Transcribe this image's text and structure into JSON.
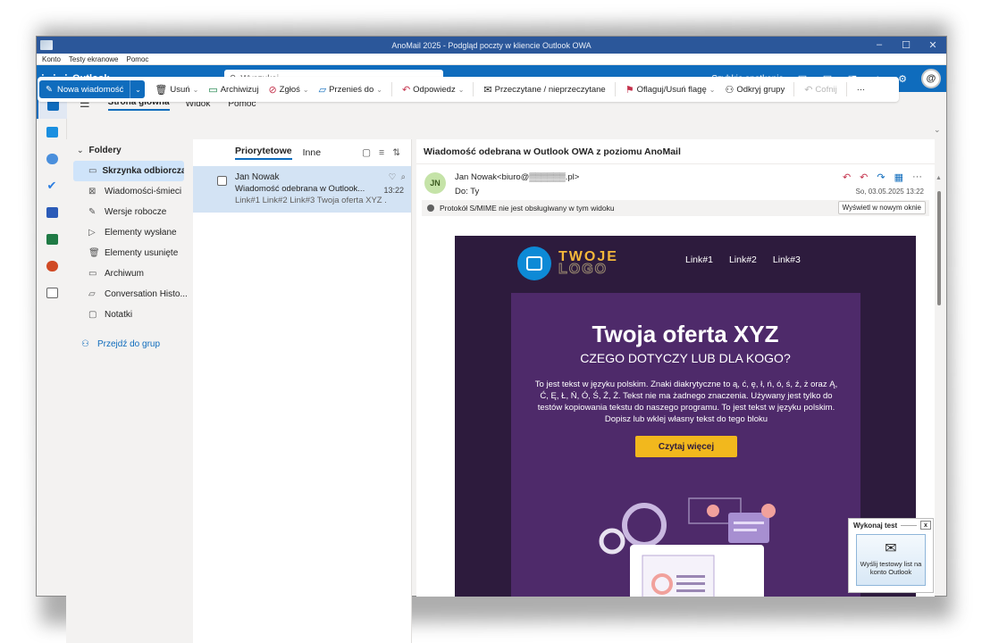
{
  "window": {
    "title": "AnoMail 2025 - Podgląd poczty w kliencie Outlook OWA",
    "controls": [
      "–",
      "☐",
      "✕"
    ]
  },
  "menubar": [
    "Konto",
    "Testy ekranowe",
    "Pomoc"
  ],
  "header": {
    "brand": "Outlook",
    "search_placeholder": "Wyszukaj",
    "quick_meeting": "Szybkie spotkanie"
  },
  "ribbon_tabs": [
    "Strona główna",
    "Widok",
    "Pomoc"
  ],
  "ribbon": {
    "new_mail": "Nowa wiadomość",
    "delete": "Usuń",
    "archive": "Archiwizuj",
    "report": "Zgłoś",
    "move_to": "Przenieś do",
    "reply": "Odpowiedz",
    "read_unread": "Przeczytane / nieprzeczytane",
    "flag": "Oflaguj/Usuń flagę",
    "discover_groups": "Odkryj grupy",
    "undo": "Cofnij",
    "more": "···"
  },
  "folders": {
    "header": "Foldery",
    "items": [
      {
        "label": "Skrzynka odbiorcza",
        "icon": "inbox-icon"
      },
      {
        "label": "Wiadomości-śmieci",
        "icon": "junk-icon"
      },
      {
        "label": "Wersje robocze",
        "icon": "draft-icon"
      },
      {
        "label": "Elementy wysłane",
        "icon": "send-icon"
      },
      {
        "label": "Elementy usunięte",
        "icon": "trash-icon"
      },
      {
        "label": "Archiwum",
        "icon": "archive-icon"
      },
      {
        "label": "Conversation Histo...",
        "icon": "folder-icon"
      },
      {
        "label": "Notatki",
        "icon": "note-icon"
      }
    ],
    "go_to_groups": "Przejdź do grup"
  },
  "message_list": {
    "tab_focused": "Priorytetowe",
    "tab_other": "Inne",
    "messages": [
      {
        "from": "Jan Nowak",
        "subject": "Wiadomość odebrana w Outlook...",
        "time": "13:22",
        "preview": "Link#1 Link#2 Link#3 Twoja oferta XYZ ..."
      }
    ]
  },
  "reading": {
    "subject": "Wiadomość odebrana w Outlook OWA z poziomu AnoMail",
    "avatar_initials": "JN",
    "sender": "Jan Nowak<biuro@▒▒▒▒▒▒.pl>",
    "to": "Do:  Ty",
    "date": "So, 03.05.2025 13:22",
    "smime_notice": "Protokół S/MIME nie jest obsługiwany w tym widoku",
    "open_new_window": "Wyświetl w nowym oknie"
  },
  "newsletter": {
    "logo_line1": "TWOJE",
    "logo_line2": "LOGO",
    "links": [
      "Link#1",
      "Link#2",
      "Link#3"
    ],
    "title": "Twoja oferta XYZ",
    "subtitle": "CZEGO DOTYCZY LUB DLA KOGO?",
    "paragraph": "To jest tekst w języku polskim. Znaki diakrytyczne to ą, ć, ę, ł, ń, ó, ś, ź, ż oraz Ą, Ć, Ę, Ł, Ń, Ó, Ś, Ź, Ż. Tekst nie ma żadnego znaczenia. Używany jest tylko do testów kopiowania tekstu do naszego programu. To jest tekst w języku polskim. Dopisz lub wklej własny tekst do tego bloku",
    "cta": "Czytaj więcej",
    "colors": {
      "background": "#2d1b3d",
      "panel": "#4e2a6a",
      "cta": "#f2b81d",
      "logo_accent": "#f4b73a"
    }
  },
  "test_panel": {
    "title": "Wykonaj test",
    "close": "x",
    "button_label": "Wyślij testowy list na konto Outlook"
  },
  "colors": {
    "accent": "#0f6cbd",
    "titlebar": "#2b579a",
    "selection": "#cfe4fa"
  }
}
